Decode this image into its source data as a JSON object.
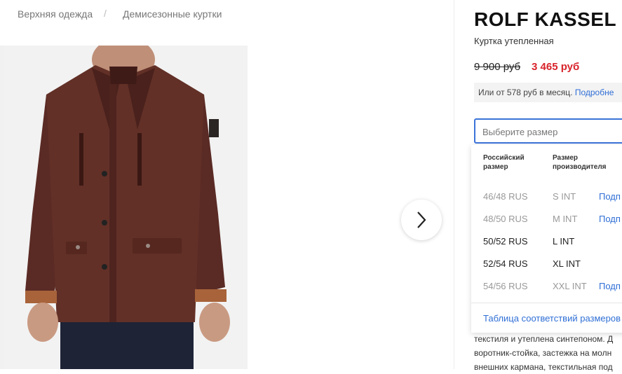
{
  "breadcrumb": [
    "Верхняя одежда",
    "Демисезонные куртки"
  ],
  "product": {
    "brand": "ROLF KASSEL",
    "subtitle": "Куртка утепленная",
    "old_price": "9 900 руб",
    "new_price": "3 465 руб",
    "installment_text": "Или от 578 руб в месяц.",
    "installment_link": "Подробне"
  },
  "size_select": {
    "placeholder": "Выберите размер",
    "header_ru": [
      "Российский",
      "размер"
    ],
    "header_int": [
      "Размер",
      "производителя"
    ],
    "rows": [
      {
        "ru": "46/48 RUS",
        "int": "S INT",
        "sub": "Подп",
        "available": false
      },
      {
        "ru": "48/50 RUS",
        "int": "M INT",
        "sub": "Подп",
        "available": false
      },
      {
        "ru": "50/52 RUS",
        "int": "L INT",
        "sub": "",
        "available": true
      },
      {
        "ru": "52/54 RUS",
        "int": "XL INT",
        "sub": "",
        "available": true
      },
      {
        "ru": "54/56 RUS",
        "int": "XXL INT",
        "sub": "Подп",
        "available": false
      }
    ],
    "table_link": "Таблица соответствий размеров"
  },
  "description": [
    "текстиля и утеплена синтепоном. Д",
    "воротник-стойка, застежка на молн",
    "внешних кармана, текстильная под"
  ],
  "colors": {
    "accent": "#3b73d9",
    "sale": "#d8232a",
    "link": "#2f6fd6"
  },
  "icons": {
    "next": "chevron-right-icon"
  }
}
